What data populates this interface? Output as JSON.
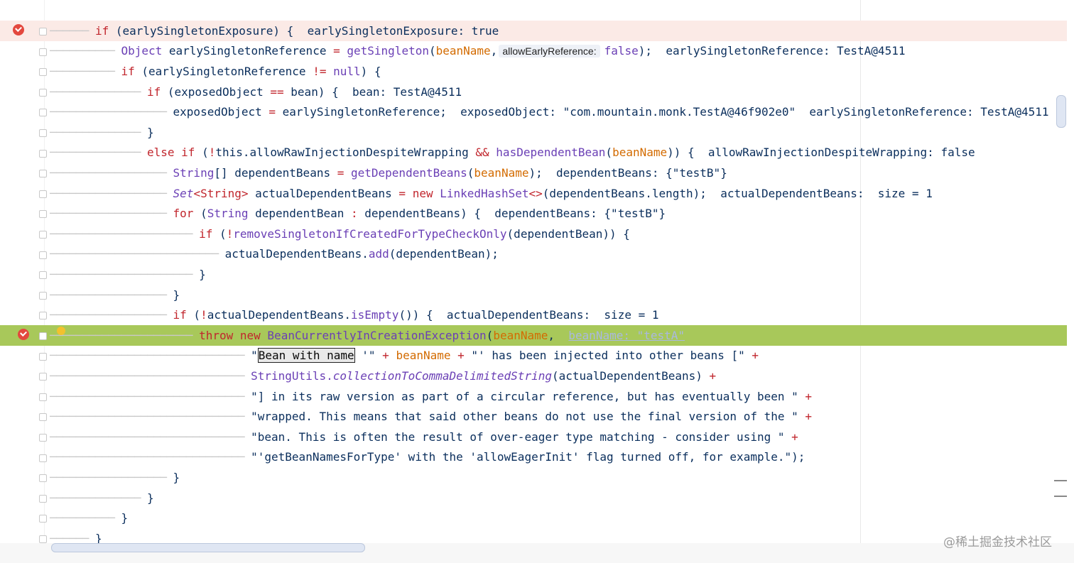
{
  "lines": [
    {
      "indent": "──────",
      "tokens": [
        {
          "t": "if",
          "c": "kw"
        },
        {
          "t": " (earlySingletonExposure) {  ",
          "c": "plain"
        },
        {
          "t": "earlySingletonExposure: true",
          "c": "hint"
        }
      ]
    },
    {
      "indent": "──────────",
      "tokens": [
        {
          "t": "Object",
          "c": "cls"
        },
        {
          "t": " earlySingletonReference ",
          "c": "plain"
        },
        {
          "t": "=",
          "c": "kw"
        },
        {
          "t": " ",
          "c": "plain"
        },
        {
          "t": "getSingleton",
          "c": "fn"
        },
        {
          "t": "(",
          "c": "plain"
        },
        {
          "t": "beanName",
          "c": "param"
        },
        {
          "t": ",",
          "c": "plain"
        },
        {
          "t": "allowEarlyReference:",
          "c": "inlay"
        },
        {
          "t": "false",
          "c": "cls"
        },
        {
          "t": ");  earlySingletonReference: TestA@4511",
          "c": "plain"
        }
      ]
    },
    {
      "indent": "──────────",
      "tokens": [
        {
          "t": "if",
          "c": "kw"
        },
        {
          "t": " (earlySingletonReference ",
          "c": "plain"
        },
        {
          "t": "!=",
          "c": "kw"
        },
        {
          "t": " ",
          "c": "plain"
        },
        {
          "t": "null",
          "c": "cls"
        },
        {
          "t": ") {",
          "c": "plain"
        }
      ]
    },
    {
      "indent": "──────────────",
      "tokens": [
        {
          "t": "if",
          "c": "kw"
        },
        {
          "t": " (exposedObject ",
          "c": "plain"
        },
        {
          "t": "==",
          "c": "kw"
        },
        {
          "t": " bean) {  bean: TestA@4511",
          "c": "plain"
        }
      ]
    },
    {
      "indent": "──────────────────",
      "tokens": [
        {
          "t": "exposedObject ",
          "c": "plain"
        },
        {
          "t": "=",
          "c": "kw"
        },
        {
          "t": " earlySingletonReference;  exposedObject: \"com.mountain.monk.TestA@46f902e0\"  earlySingletonReference: TestA@4511",
          "c": "plain"
        }
      ]
    },
    {
      "indent": "──────────────",
      "tokens": [
        {
          "t": "}",
          "c": "plain"
        }
      ]
    },
    {
      "indent": "──────────────",
      "tokens": [
        {
          "t": "else if",
          "c": "kw"
        },
        {
          "t": " (",
          "c": "plain"
        },
        {
          "t": "!",
          "c": "kw"
        },
        {
          "t": "this.allowRawInjectionDespiteWrapping ",
          "c": "plain"
        },
        {
          "t": "&&",
          "c": "kw"
        },
        {
          "t": " ",
          "c": "plain"
        },
        {
          "t": "hasDependentBean",
          "c": "fn"
        },
        {
          "t": "(",
          "c": "plain"
        },
        {
          "t": "beanName",
          "c": "param"
        },
        {
          "t": ")) {  allowRawInjectionDespiteWrapping: false",
          "c": "plain"
        }
      ]
    },
    {
      "indent": "──────────────────",
      "tokens": [
        {
          "t": "String",
          "c": "cls"
        },
        {
          "t": "[] dependentBeans ",
          "c": "plain"
        },
        {
          "t": "=",
          "c": "kw"
        },
        {
          "t": " ",
          "c": "plain"
        },
        {
          "t": "getDependentBeans",
          "c": "fn"
        },
        {
          "t": "(",
          "c": "plain"
        },
        {
          "t": "beanName",
          "c": "param"
        },
        {
          "t": ");  dependentBeans: {\"testB\"}",
          "c": "plain"
        }
      ]
    },
    {
      "indent": "──────────────────",
      "tokens": [
        {
          "t": "Set",
          "c": "ital"
        },
        {
          "t": "<String>",
          "c": "kw"
        },
        {
          "t": " actualDependentBeans ",
          "c": "plain"
        },
        {
          "t": "=",
          "c": "kw"
        },
        {
          "t": " ",
          "c": "plain"
        },
        {
          "t": "new",
          "c": "kw"
        },
        {
          "t": " ",
          "c": "plain"
        },
        {
          "t": "LinkedHashSet",
          "c": "cls"
        },
        {
          "t": "<>",
          "c": "kw"
        },
        {
          "t": "(dependentBeans.length);  actualDependentBeans:  size = 1",
          "c": "plain"
        }
      ]
    },
    {
      "indent": "──────────────────",
      "tokens": [
        {
          "t": "for",
          "c": "kw"
        },
        {
          "t": " (",
          "c": "plain"
        },
        {
          "t": "String",
          "c": "cls"
        },
        {
          "t": " dependentBean ",
          "c": "plain"
        },
        {
          "t": ":",
          "c": "kw"
        },
        {
          "t": " dependentBeans) {  dependentBeans: {\"testB\"}",
          "c": "plain"
        }
      ]
    },
    {
      "indent": "──────────────────────",
      "tokens": [
        {
          "t": "if",
          "c": "kw"
        },
        {
          "t": " (",
          "c": "plain"
        },
        {
          "t": "!",
          "c": "kw"
        },
        {
          "t": "removeSingletonIfCreatedForTypeCheckOnly",
          "c": "fn"
        },
        {
          "t": "(dependentBean)) {",
          "c": "plain"
        }
      ]
    },
    {
      "indent": "──────────────────────────",
      "tokens": [
        {
          "t": "actualDependentBeans.",
          "c": "plain"
        },
        {
          "t": "add",
          "c": "fn"
        },
        {
          "t": "(dependentBean);",
          "c": "plain"
        }
      ]
    },
    {
      "indent": "──────────────────────",
      "tokens": [
        {
          "t": "}",
          "c": "plain"
        }
      ]
    },
    {
      "indent": "──────────────────",
      "tokens": [
        {
          "t": "}",
          "c": "plain"
        }
      ]
    },
    {
      "indent": "──────────────────",
      "tokens": [
        {
          "t": "if",
          "c": "kw"
        },
        {
          "t": " (",
          "c": "plain"
        },
        {
          "t": "!",
          "c": "kw"
        },
        {
          "t": "actualDependentBeans.",
          "c": "plain"
        },
        {
          "t": "isEmpty",
          "c": "fn"
        },
        {
          "t": "()) {  actualDependentBeans:  size = 1",
          "c": "plain"
        }
      ]
    },
    {
      "indent": "──────────────────────",
      "tokens": [
        {
          "t": "throw",
          "c": "kw"
        },
        {
          "t": " ",
          "c": "plain"
        },
        {
          "t": "new",
          "c": "kw"
        },
        {
          "t": " ",
          "c": "plain"
        },
        {
          "t": "BeanCurrentlyInCreationException",
          "c": "cls"
        },
        {
          "t": "(",
          "c": "plain"
        },
        {
          "t": "beanName",
          "c": "param"
        },
        {
          "t": ",  ",
          "c": "plain"
        },
        {
          "t": "beanName: \"testA\"",
          "c": "ghost"
        }
      ]
    },
    {
      "indent": "──────────────────────────────",
      "tokens": [
        {
          "t": "\"",
          "c": "str"
        },
        {
          "t": "Bean with name",
          "c": "boxsel"
        },
        {
          "t": " '\" ",
          "c": "str"
        },
        {
          "t": "+",
          "c": "kw"
        },
        {
          "t": " ",
          "c": "plain"
        },
        {
          "t": "beanName",
          "c": "param"
        },
        {
          "t": " ",
          "c": "plain"
        },
        {
          "t": "+",
          "c": "kw"
        },
        {
          "t": " \"' has been injected into other beans [\" ",
          "c": "str"
        },
        {
          "t": "+",
          "c": "kw"
        }
      ]
    },
    {
      "indent": "──────────────────────────────",
      "tokens": [
        {
          "t": "StringUtils.",
          "c": "cls"
        },
        {
          "t": "collectionToCommaDelimitedString",
          "c": "ital"
        },
        {
          "t": "(actualDependentBeans) ",
          "c": "plain"
        },
        {
          "t": "+",
          "c": "kw"
        }
      ]
    },
    {
      "indent": "──────────────────────────────",
      "tokens": [
        {
          "t": "\"] in its raw version as part of a circular reference, but has eventually been \" ",
          "c": "str"
        },
        {
          "t": "+",
          "c": "kw"
        }
      ]
    },
    {
      "indent": "──────────────────────────────",
      "tokens": [
        {
          "t": "\"wrapped. This means that said other beans do not use the final version of the \" ",
          "c": "str"
        },
        {
          "t": "+",
          "c": "kw"
        }
      ]
    },
    {
      "indent": "──────────────────────────────",
      "tokens": [
        {
          "t": "\"bean. This is often the result of over-eager type matching - consider using \" ",
          "c": "str"
        },
        {
          "t": "+",
          "c": "kw"
        }
      ]
    },
    {
      "indent": "──────────────────────────────",
      "tokens": [
        {
          "t": "\"'getBeanNamesForType' with the 'allowEagerInit' flag turned off, for example.\");",
          "c": "str"
        }
      ]
    },
    {
      "indent": "──────────────────",
      "tokens": [
        {
          "t": "}",
          "c": "plain"
        }
      ]
    },
    {
      "indent": "──────────────",
      "tokens": [
        {
          "t": "}",
          "c": "plain"
        }
      ]
    },
    {
      "indent": "──────────",
      "tokens": [
        {
          "t": "}",
          "c": "plain"
        }
      ]
    },
    {
      "indent": "──────",
      "tokens": [
        {
          "t": "}",
          "c": "plain"
        }
      ]
    }
  ],
  "watermark": "@稀土掘金技术社区",
  "colors": {
    "breakpoint_line": "#fbeae6",
    "execution_line": "#a8c85a",
    "keyword": "#c1262d",
    "type": "#6a3fb5",
    "param": "#d36b00"
  }
}
